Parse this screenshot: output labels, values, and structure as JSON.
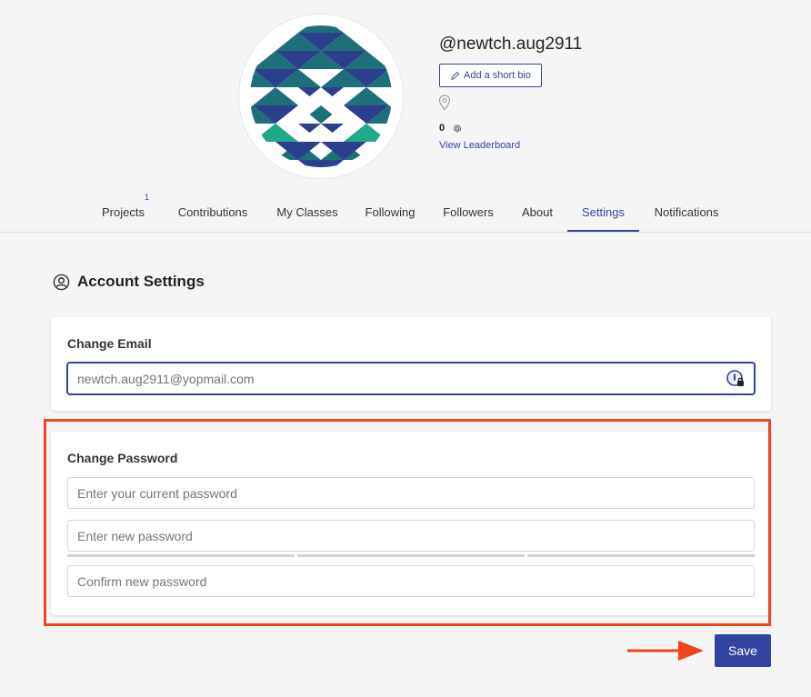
{
  "profile": {
    "username": "@newtch.aug2911",
    "bio_button": "Add a short bio",
    "points": "0",
    "leaderboard_link": "View Leaderboard"
  },
  "tabs": [
    {
      "label": "Projects",
      "badge": "1"
    },
    {
      "label": "Contributions"
    },
    {
      "label": "My Classes"
    },
    {
      "label": "Following"
    },
    {
      "label": "Followers"
    },
    {
      "label": "About"
    },
    {
      "label": "Settings",
      "active": true
    },
    {
      "label": "Notifications"
    }
  ],
  "account": {
    "title": "Account Settings",
    "email_card": {
      "label": "Change Email",
      "placeholder": "newtch.aug2911@yopmail.com"
    },
    "password_card": {
      "label": "Change Password",
      "current_placeholder": "Enter your current password",
      "new_placeholder": "Enter new password",
      "confirm_placeholder": "Confirm new password"
    },
    "save_label": "Save"
  },
  "colors": {
    "accent": "#3344a0",
    "highlight": "#f0441c",
    "avatar_teal": "#1f6f7a",
    "avatar_navy": "#2c3f8c",
    "avatar_green": "#1fa98a"
  },
  "icons": [
    "pencil-icon",
    "location-pin-icon",
    "fingerprint-icon",
    "account-circle-icon",
    "password-manager-icon",
    "arrow-right-icon"
  ]
}
